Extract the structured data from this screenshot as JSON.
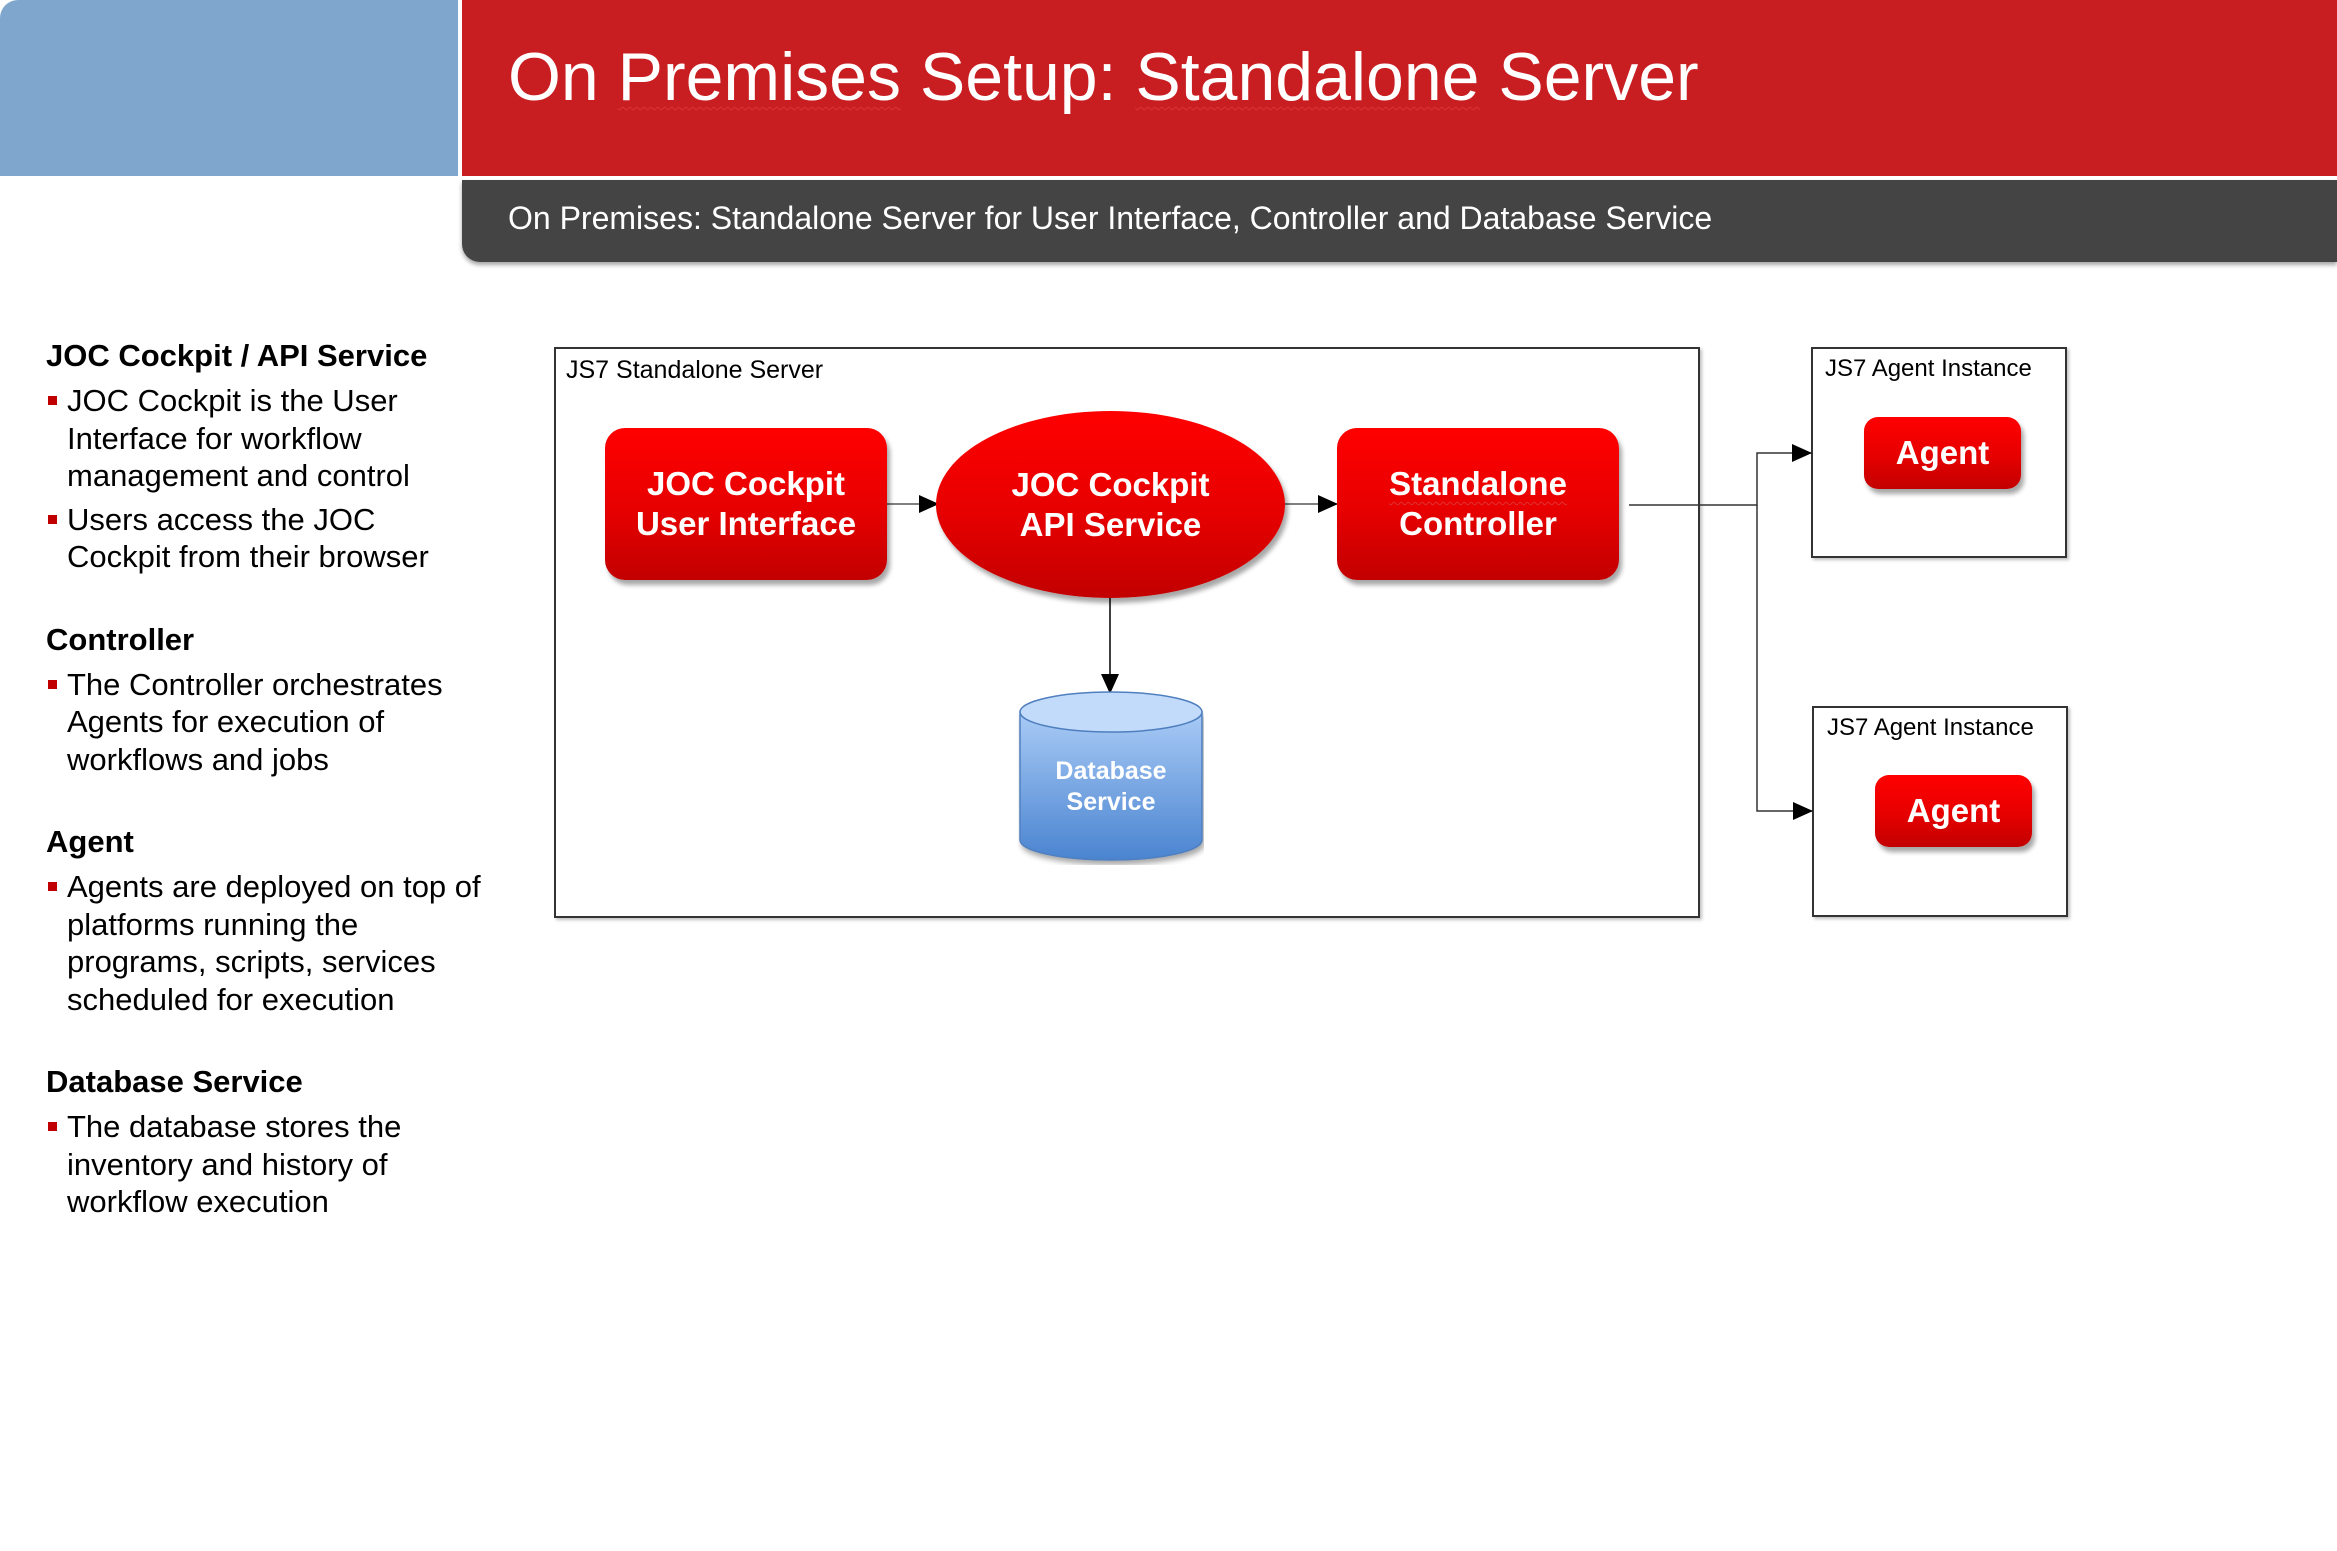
{
  "header": {
    "title_parts": [
      "On ",
      "Premises",
      " Setup: ",
      "Standalone",
      " Server"
    ],
    "subtitle": "On Premises: Standalone Server for User Interface, Controller and Database Service"
  },
  "sidebar": {
    "sections": [
      {
        "heading": "JOC Cockpit / API Service",
        "bullets": [
          "JOC Cockpit is the User Interface for workflow management and control",
          "Users access the JOC Cockpit from their browser"
        ]
      },
      {
        "heading": "Controller",
        "bullets": [
          "The Controller orchestrates Agents for execution of workflows and jobs"
        ]
      },
      {
        "heading": "Agent",
        "bullets": [
          "Agents are deployed on top of platforms running the programs, scripts, services scheduled for execution"
        ]
      },
      {
        "heading": "Database Service",
        "bullets": [
          "The database stores the inventory and history of workflow execution"
        ]
      }
    ]
  },
  "diagram": {
    "server_label": "JS7 Standalone Server",
    "nodes": {
      "ui": {
        "line1": "JOC Cockpit",
        "line2": "User Interface"
      },
      "api": {
        "line1": "JOC Cockpit",
        "line2": "API Service"
      },
      "controller": {
        "line1": "Standalone",
        "line2": "Controller"
      },
      "database": {
        "line1": "Database",
        "line2": "Service"
      }
    },
    "agents": [
      {
        "instance_label": "JS7 Agent Instance",
        "label": "Agent"
      },
      {
        "instance_label": "JS7 Agent Instance",
        "label": "Agent"
      }
    ],
    "colors": {
      "header_red": "#c91e21",
      "header_blue": "#7fa6cc",
      "subheader_gray": "#444444",
      "node_red": "#e60000",
      "db_blue": "#7aaeea",
      "bullet_red": "#c00000"
    }
  }
}
